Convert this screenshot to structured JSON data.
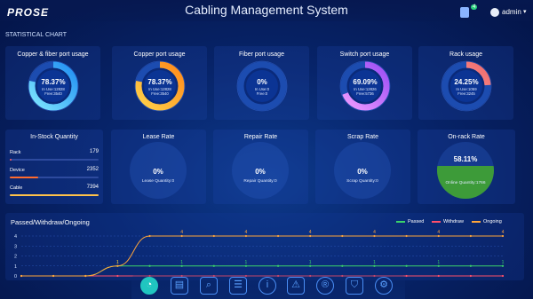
{
  "header": {
    "logo": "PROSE",
    "title": "Cabling Management System",
    "badge": "4",
    "user": "admin"
  },
  "section_title": "STATISTICAL CHART",
  "gauges": [
    {
      "title": "Copper & fiber port usage",
      "pct": "78.37%",
      "inuse": "In Use:12828",
      "free": "Free:3540",
      "value": 78.37,
      "color_a": "#7fe7ff",
      "color_b": "#1f8df2"
    },
    {
      "title": "Copper port usage",
      "pct": "78.37%",
      "inuse": "In Use:12828",
      "free": "Free:3540",
      "value": 78.37,
      "color_a": "#ffd24a",
      "color_b": "#ff8a1a"
    },
    {
      "title": "Fiber port usage",
      "pct": "0%",
      "inuse": "In Use:0",
      "free": "Free:0",
      "value": 0,
      "color_a": "#7fe7ff",
      "color_b": "#1f8df2"
    },
    {
      "title": "Switch port usage",
      "pct": "69.09%",
      "inuse": "In Use:12826",
      "free": "Free:5736",
      "value": 69.09,
      "color_a": "#f09cff",
      "color_b": "#9a4df5"
    },
    {
      "title": "Rack usage",
      "pct": "24.25%",
      "inuse": "In Use:1059",
      "free": "Free:3245",
      "value": 24.25,
      "color_a": "#ffb0b0",
      "color_b": "#f06a6a"
    }
  ],
  "stock": {
    "title": "In-Stock Quantity",
    "rows": [
      {
        "label": "Rack",
        "value": "179",
        "fraction": 0.02,
        "color": "#ff5a5a"
      },
      {
        "label": "Device",
        "value": "2352",
        "fraction": 0.32,
        "color": "#ff6b2e"
      },
      {
        "label": "Cable",
        "value": "7394",
        "fraction": 1.0,
        "color": "#ffc24a"
      }
    ]
  },
  "rates": [
    {
      "title": "Lease Rate",
      "pct": "0%",
      "quantity": "Lease Quantity:0"
    },
    {
      "title": "Repair Rate",
      "pct": "0%",
      "quantity": "Repair Quantity:0"
    },
    {
      "title": "Scrap Rate",
      "pct": "0%",
      "quantity": "Scrap Quantity:0"
    },
    {
      "title": "On-rack Rate",
      "pct": "58.11%",
      "quantity": "Online Quantity:1766",
      "fill": 0.5811,
      "fill_color": "#3d9b39"
    }
  ],
  "chart_data": {
    "type": "line",
    "title": "Passed/Withdraw/Ongoing",
    "ylim": [
      0,
      4
    ],
    "yticks": [
      "0",
      "1",
      "2",
      "3",
      "4"
    ],
    "x_points": 16,
    "series": [
      {
        "name": "Passed",
        "color": "#3bd36a",
        "values": [
          0,
          0,
          0,
          1,
          1,
          1,
          1,
          1,
          1,
          1,
          1,
          1,
          1,
          1,
          1,
          1
        ]
      },
      {
        "name": "Withdraw",
        "color": "#ff4f6a",
        "values": [
          0,
          0,
          0,
          0,
          0,
          0,
          0,
          0,
          0,
          0,
          0,
          0,
          0,
          0,
          0,
          0
        ]
      },
      {
        "name": "Ongoing",
        "color": "#ffa53a",
        "values": [
          0,
          0,
          0,
          1,
          4,
          4,
          4,
          4,
          4,
          4,
          4,
          4,
          4,
          4,
          4,
          4
        ]
      }
    ],
    "grid": true,
    "legend": "top-right"
  },
  "dock": [
    {
      "name": "dashboard-icon",
      "glyph": "◔",
      "active": true
    },
    {
      "name": "folder-icon",
      "glyph": "▤",
      "active": false
    },
    {
      "name": "search-icon",
      "glyph": "⌕",
      "active": false
    },
    {
      "name": "list-icon",
      "glyph": "☰",
      "active": false
    },
    {
      "name": "info-icon",
      "glyph": "i",
      "active": false
    },
    {
      "name": "warning-icon",
      "glyph": "⚠",
      "active": false
    },
    {
      "name": "registered-icon",
      "glyph": "®",
      "active": false
    },
    {
      "name": "security-icon",
      "glyph": "⛉",
      "active": false
    },
    {
      "name": "settings-icon",
      "glyph": "⚙",
      "active": false
    }
  ]
}
